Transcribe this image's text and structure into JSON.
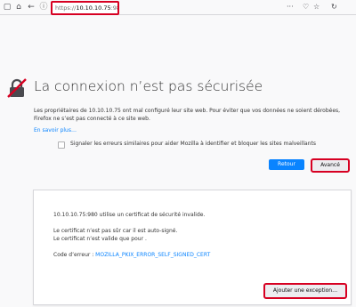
{
  "browser": {
    "url": {
      "scheme": "https://",
      "host": "10.10.10.75",
      "port": ":980"
    },
    "menu_dots": "···"
  },
  "error": {
    "title": "La connexion n’est pas sécurisée",
    "description": "Les propriétaires de 10.10.10.75 ont mal configuré leur site web. Pour éviter que vos données ne soient dérobées, Firefox ne s’est pas connecté à ce site web.",
    "learn_more": "En savoir plus…",
    "report_checkbox_label": "Signaler les erreurs similaires pour aider Mozilla à identifier et bloquer les sites malveillants",
    "report_checked": false,
    "retour_button": "Retour",
    "advanced_button": "Avancé"
  },
  "advanced_panel": {
    "line1": "10.10.10.75:980 utilise un certificat de sécurité invalide.",
    "line2": "Le certificat n’est pas sûr car il est auto-signé.",
    "line3": "Le certificat n’est valide que pour .",
    "error_code_label": "Code d’erreur : ",
    "error_code": "MOZILLA_PKIX_ERROR_SELF_SIGNED_CERT",
    "add_exception_button": "Ajouter une exception…"
  },
  "colors": {
    "accent": "#0a84ff",
    "highlight": "#d70022",
    "icon_red": "#d70022"
  }
}
